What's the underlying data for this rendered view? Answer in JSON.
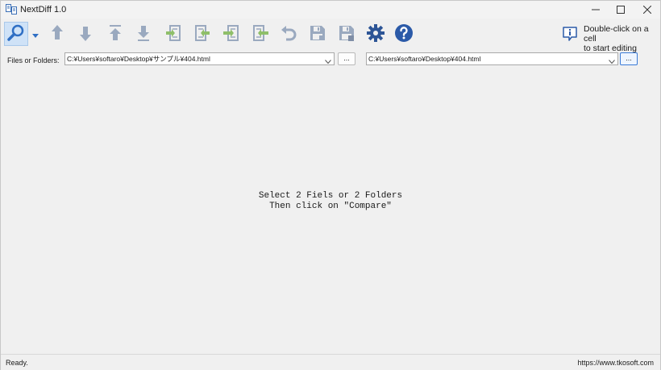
{
  "window": {
    "title": "NextDiff 1.0"
  },
  "toolbar": {
    "buttons": [
      {
        "name": "compare",
        "icon": "magnifier-icon"
      },
      {
        "name": "prev-diff",
        "icon": "arrow-up-icon"
      },
      {
        "name": "next-diff",
        "icon": "arrow-down-icon"
      },
      {
        "name": "first-diff",
        "icon": "arrow-up-to-line-icon"
      },
      {
        "name": "last-diff",
        "icon": "arrow-down-to-line-icon"
      },
      {
        "name": "copy-left-to-right",
        "icon": "copy-right-icon"
      },
      {
        "name": "copy-right-to-left",
        "icon": "copy-left-icon"
      },
      {
        "name": "copy-all-right",
        "icon": "copy-all-right-icon"
      },
      {
        "name": "copy-all-left",
        "icon": "copy-all-left-icon"
      },
      {
        "name": "undo",
        "icon": "undo-icon"
      },
      {
        "name": "save-left",
        "icon": "save-icon"
      },
      {
        "name": "save-right",
        "icon": "save-as-icon"
      },
      {
        "name": "settings",
        "icon": "gear-icon"
      },
      {
        "name": "help",
        "icon": "help-icon"
      }
    ],
    "tip_line1": "Double-click on a cell",
    "tip_line2": "to start editing"
  },
  "paths": {
    "label": "Files or Folders:",
    "left_value": "C:¥Users¥softaro¥Desktop¥サンプル¥404.html",
    "right_value": "C:¥Users¥softaro¥Desktop¥404.html",
    "browse_label": "..."
  },
  "main": {
    "message_line1": "Select 2 Fiels or 2 Folders",
    "message_line2": "Then click on \"Compare\""
  },
  "status": {
    "left": "Ready.",
    "right": "https://www.tkosoft.com"
  },
  "colors": {
    "accent": "#2f6fc4",
    "icon_gray": "#9aa9bf",
    "icon_green": "#8fbf6a",
    "help_blue": "#2b5aa8",
    "gear_blue": "#2d5596"
  }
}
